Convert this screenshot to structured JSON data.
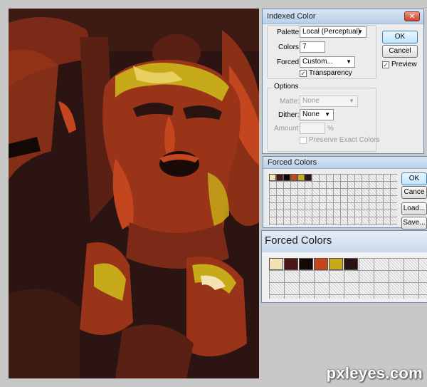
{
  "indexed_color": {
    "title": "Indexed Color",
    "close_glyph": "✕",
    "palette_label": "Palette:",
    "palette_value": "Local (Perceptual)",
    "colors_label": "Colors:",
    "colors_value": "7",
    "forced_label": "Forced:",
    "forced_value": "Custom...",
    "transparency_label": "Transparency",
    "transparency_checked": true,
    "options_legend": "Options",
    "matte_label": "Matte:",
    "matte_value": "None",
    "dither_label": "Dither:",
    "dither_value": "None",
    "amount_label": "Amount:",
    "amount_unit": "%",
    "preserve_label": "Preserve Exact Colors",
    "ok_label": "OK",
    "cancel_label": "Cancel",
    "preview_label": "Preview",
    "preview_checked": true
  },
  "forced_colors_small": {
    "title": "Forced Colors",
    "ok_label": "OK",
    "cancel_label": "Cance",
    "load_label": "Load...",
    "save_label": "Save..."
  },
  "forced_colors_zoom": {
    "title": "Forced Colors"
  },
  "swatch_colors": [
    "#f3e2b4",
    "#4a1616",
    "#140806",
    "#c3461f",
    "#c7aa1a",
    "#2a1411"
  ],
  "watermark": "pxleyes.com"
}
